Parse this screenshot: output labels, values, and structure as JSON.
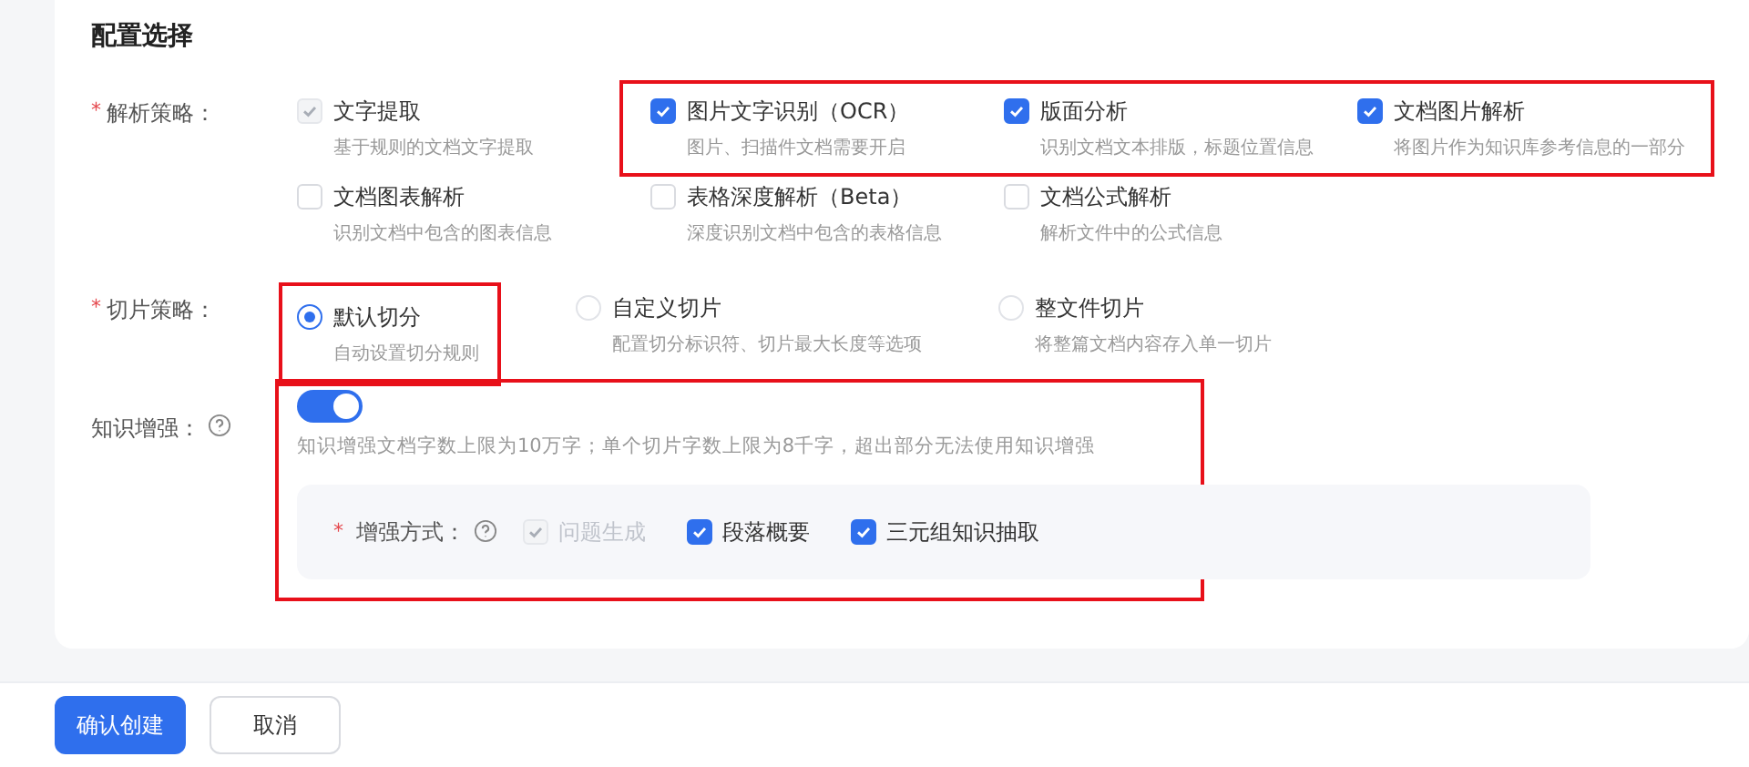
{
  "section_title": "配置选择",
  "parse_strategy": {
    "label": "解析策略：",
    "required_mark": "*",
    "rows": [
      [
        {
          "title": "文字提取",
          "desc": "基于规则的文档文字提取",
          "checked": true,
          "disabled": true,
          "highlighted": false
        },
        {
          "title": "图片文字识别（OCR）",
          "desc": "图片、扫描件文档需要开启",
          "checked": true,
          "disabled": false,
          "highlighted": true
        },
        {
          "title": "版面分析",
          "desc": "识别文档文本排版，标题位置信息",
          "checked": true,
          "disabled": false,
          "highlighted": true
        },
        {
          "title": "文档图片解析",
          "desc": "将图片作为知识库参考信息的一部分",
          "checked": true,
          "disabled": false,
          "highlighted": true
        }
      ],
      [
        {
          "title": "文档图表解析",
          "desc": "识别文档中包含的图表信息",
          "checked": false,
          "disabled": false,
          "highlighted": false
        },
        {
          "title": "表格深度解析（Beta）",
          "desc": "深度识别文档中包含的表格信息",
          "checked": false,
          "disabled": false,
          "highlighted": false
        },
        {
          "title": "文档公式解析",
          "desc": "解析文件中的公式信息",
          "checked": false,
          "disabled": false,
          "highlighted": false
        }
      ]
    ]
  },
  "chunk_strategy": {
    "label": "切片策略：",
    "required_mark": "*",
    "options": [
      {
        "title": "默认切分",
        "desc": "自动设置切分规则",
        "selected": true,
        "highlighted": true
      },
      {
        "title": "自定义切片",
        "desc": "配置切分标识符、切片最大长度等选项",
        "selected": false,
        "highlighted": false
      },
      {
        "title": "整文件切片",
        "desc": "将整篇文档内容存入单一切片",
        "selected": false,
        "highlighted": false
      }
    ]
  },
  "knowledge_enhancement": {
    "label": "知识增强：",
    "on": true,
    "highlighted": true,
    "note": "知识增强文档字数上限为10万字；单个切片字数上限为8千字，超出部分无法使用知识增强",
    "method": {
      "label": "增强方式：",
      "required_mark": "*",
      "options": [
        {
          "title": "问题生成",
          "checked": true,
          "disabled": true
        },
        {
          "title": "段落概要",
          "checked": true,
          "disabled": false
        },
        {
          "title": "三元组知识抽取",
          "checked": true,
          "disabled": false
        }
      ]
    }
  },
  "buttons": [
    {
      "label": "确认创建",
      "kind": "primary"
    },
    {
      "label": "取消",
      "kind": "default"
    }
  ]
}
